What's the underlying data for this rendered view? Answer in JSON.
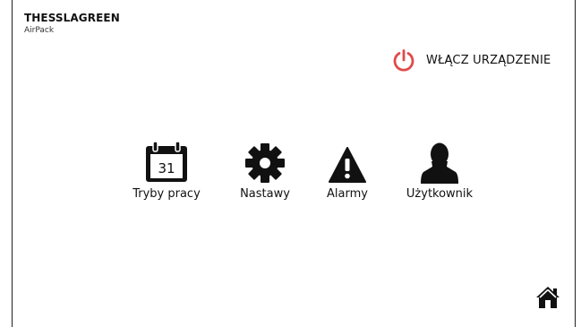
{
  "brand": {
    "title": "THESSLAGREEN",
    "subtitle": "AirPack"
  },
  "power": {
    "icon": "power-icon",
    "label": "WŁĄCZ URZĄDZENIE",
    "color": "#e04a4a"
  },
  "menu": {
    "items": [
      {
        "icon": "calendar-icon",
        "label": "Tryby pracy",
        "calendar_day": "31"
      },
      {
        "icon": "gear-icon",
        "label": "Nastawy"
      },
      {
        "icon": "warning-icon",
        "label": "Alarmy"
      },
      {
        "icon": "user-icon",
        "label": "Użytkownik"
      }
    ]
  },
  "home": {
    "icon": "home-icon"
  }
}
